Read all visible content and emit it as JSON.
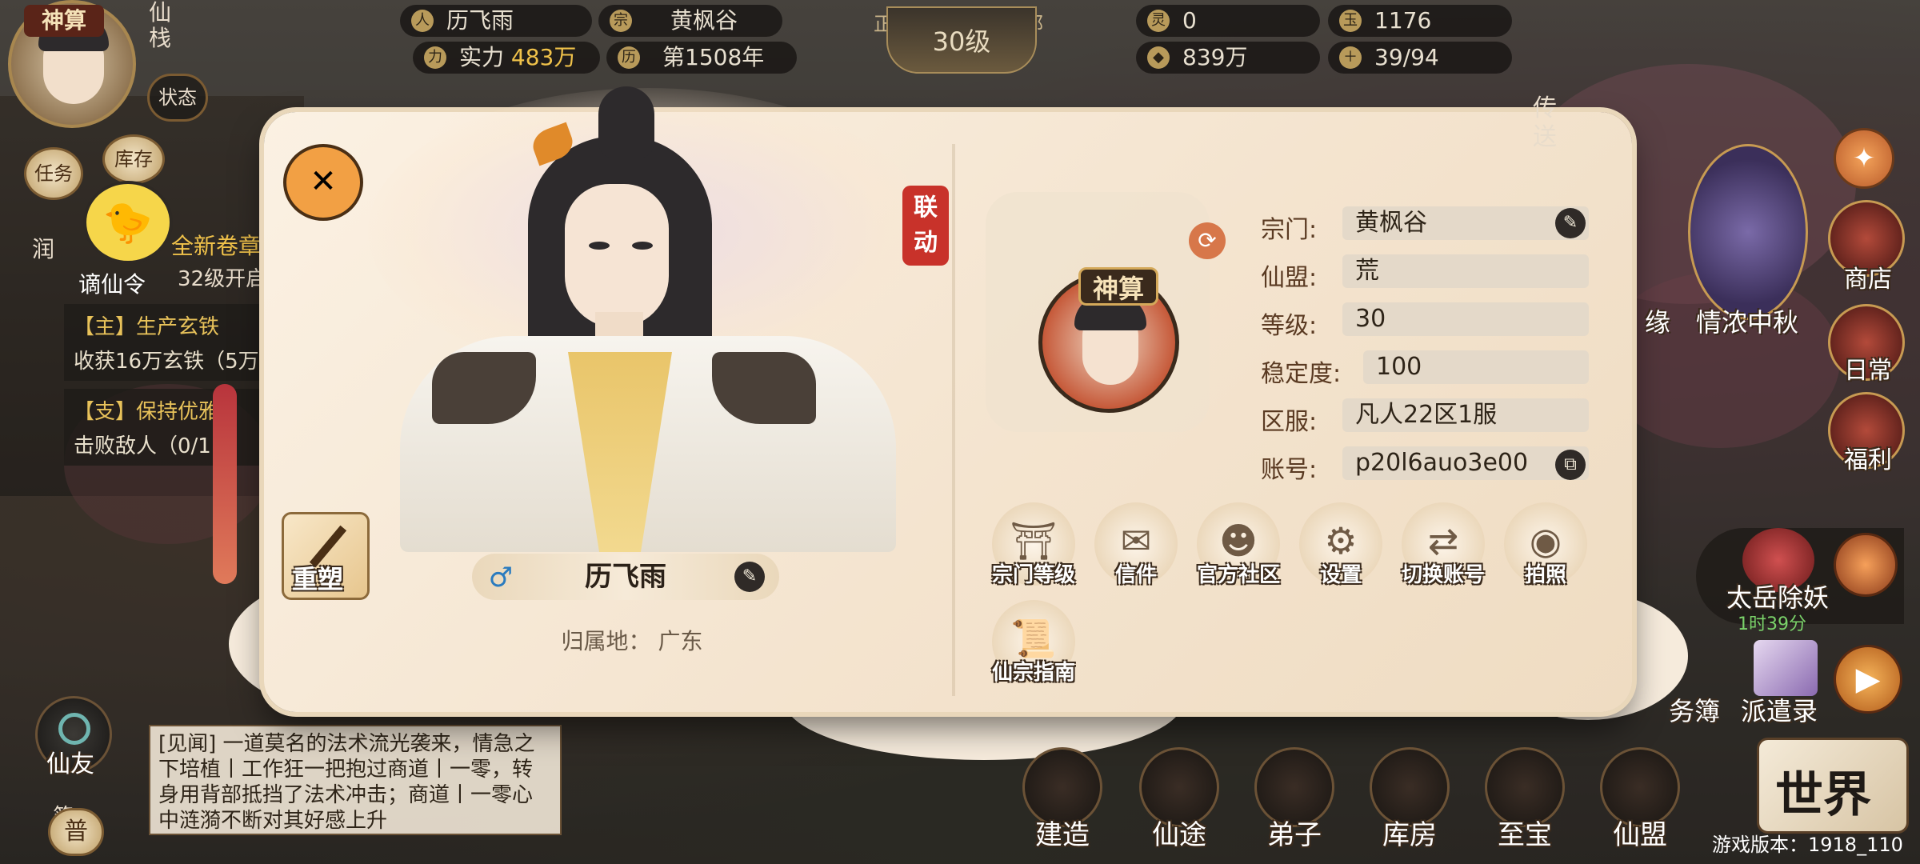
{
  "top_bar": {
    "player_name": "历飞雨",
    "sect": "黄枫谷",
    "power_label": "实力",
    "power_value": "483万",
    "year": "第1508年",
    "alignment_left": "正",
    "alignment_right": "邪",
    "level": "30级",
    "res1": "0",
    "res2": "1176",
    "res3": "839万",
    "res4": "39/94"
  },
  "left_side": {
    "avatar_badge": "神算",
    "inn": "仙栈",
    "status": "状态",
    "task": "任务",
    "storage": "库存",
    "edict": "谪仙令",
    "chapter_text": "全新卷章",
    "chapter_sub": "32级开启",
    "quest_main_title": "【主】生产玄铁",
    "quest_main_desc": "收获16万玄铁（5万",
    "quest_side_title": "【支】保持优雅",
    "quest_side_desc": "击败敌人（0/1",
    "friend": "仙友",
    "simple": "简",
    "general": "普",
    "left_cut": "润"
  },
  "log": {
    "text": "[见闻] 一道莫名的法术流光袭来，情急之下培植丨工作狂一把抱过商道丨一零，转身用背部抵挡了法术冲击；商道丨一零心中涟漪不断对其好感上升"
  },
  "panel": {
    "collab_seal": "联动",
    "reshape": "重塑",
    "char_name": "历飞雨",
    "origin_label": "归属地：",
    "origin_value": "广东",
    "avatar_badge": "神算",
    "info": [
      {
        "label": "宗门:",
        "value": "黄枫谷"
      },
      {
        "label": "仙盟:",
        "value": "荒"
      },
      {
        "label": "等级:",
        "value": "30"
      },
      {
        "label": "稳定度:",
        "value": "100"
      },
      {
        "label": "区服:",
        "value": "凡人22区1服"
      },
      {
        "label": "账号:",
        "value": "p20l6auo3e00"
      }
    ],
    "options": [
      "宗门等级",
      "信件",
      "官方社区",
      "设置",
      "切换账号",
      "拍照",
      "仙宗指南"
    ]
  },
  "right_side": {
    "teleport": "传送",
    "shop": "商店",
    "daily": "日常",
    "welfare": "福利",
    "mid_autumn": "情浓中秋",
    "fate": "缘",
    "boss": "太岳除妖",
    "boss_timer": "1时39分",
    "tasks": "务簿",
    "dispatch": "派遣录",
    "world": "世界"
  },
  "bottom_nav": [
    "建造",
    "仙途",
    "弟子",
    "库房",
    "至宝",
    "仙盟"
  ],
  "version": "游戏版本：1918_110"
}
